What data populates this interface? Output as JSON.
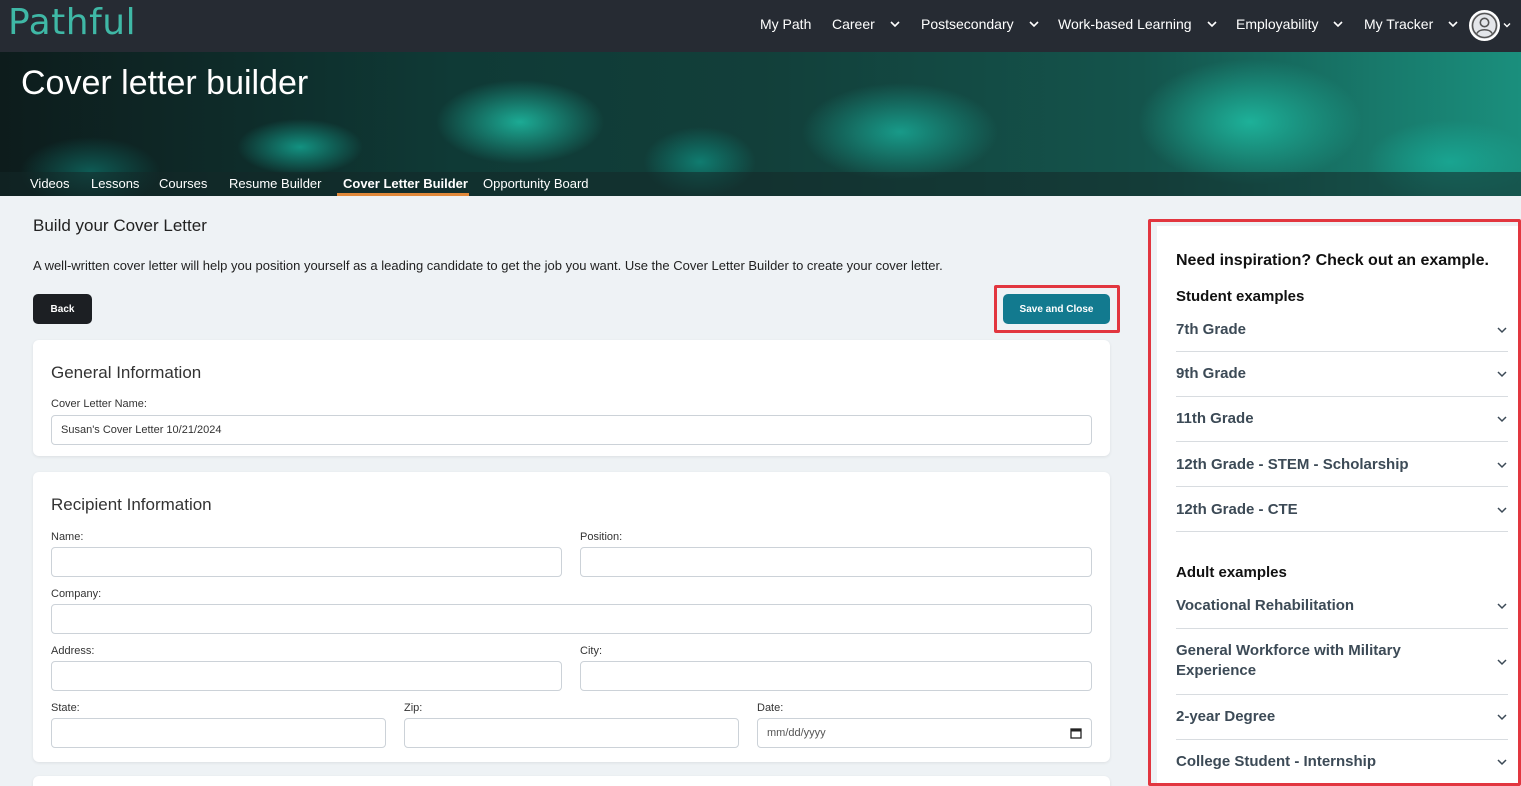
{
  "brand": {
    "logo_text": "Pathful",
    "accent": "#3fb8a6"
  },
  "nav": {
    "items": [
      {
        "label": "My Path",
        "dropdown": false
      },
      {
        "label": "Career",
        "dropdown": true
      },
      {
        "label": "Postsecondary",
        "dropdown": true
      },
      {
        "label": "Work-based Learning",
        "dropdown": true
      },
      {
        "label": "Employability",
        "dropdown": true
      },
      {
        "label": "My Tracker",
        "dropdown": true
      }
    ],
    "avatar_icon": "user-circle-icon"
  },
  "hero": {
    "title": "Cover letter builder",
    "tabs": [
      "Videos",
      "Lessons",
      "Courses",
      "Resume Builder",
      "Cover Letter Builder",
      "Opportunity Board"
    ],
    "active_tab": "Cover Letter Builder"
  },
  "main": {
    "title": "Build your Cover Letter",
    "intro": "A well-written cover letter will help you position yourself as a leading candidate to get the job you want. Use the Cover Letter Builder to create your cover letter.",
    "back_label": "Back",
    "save_label": "Save and Close"
  },
  "general": {
    "title": "General Information",
    "name_label": "Cover Letter Name:",
    "name_value": "Susan's Cover Letter 10/21/2024"
  },
  "recipient": {
    "title": "Recipient Information",
    "name_label": "Name:",
    "position_label": "Position:",
    "company_label": "Company:",
    "address_label": "Address:",
    "city_label": "City:",
    "state_label": "State:",
    "zip_label": "Zip:",
    "date_label": "Date:",
    "date_placeholder": "mm/dd/yyyy"
  },
  "side": {
    "title": "Need inspiration? Check out an example.",
    "student_heading": "Student examples",
    "student_items": [
      "7th Grade",
      "9th Grade",
      "11th Grade",
      "12th Grade - STEM - Scholarship",
      "12th Grade - CTE"
    ],
    "adult_heading": "Adult examples",
    "adult_items": [
      "Vocational Rehabilitation",
      "General Workforce with Military Experience",
      "2-year Degree",
      "College Student - Internship"
    ]
  },
  "colors": {
    "nav_bg": "#262b33",
    "save_btn": "#127a8f",
    "highlight": "#e2363f",
    "tab_underline": "#e0883a"
  }
}
